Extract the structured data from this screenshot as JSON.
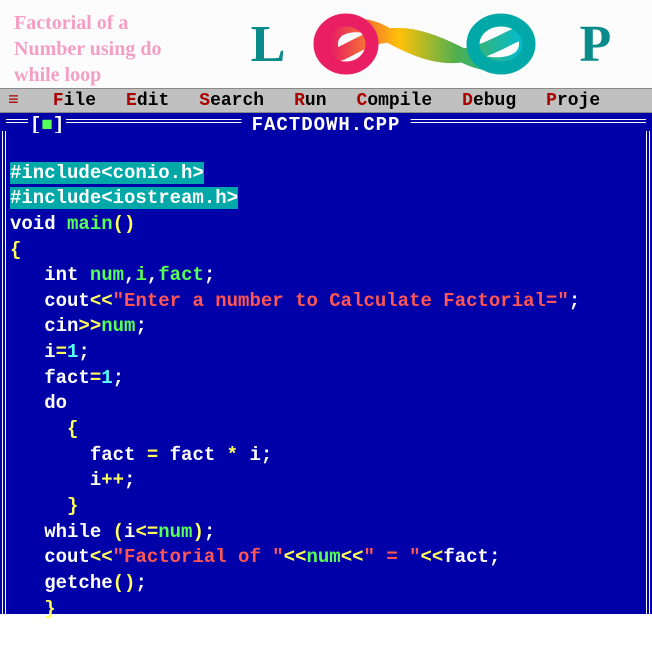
{
  "header": {
    "title": "Factorial of a Number using do while loop",
    "logo_l": "L",
    "logo_p": "P"
  },
  "menu": {
    "icon": "≡",
    "items": [
      {
        "hotkey": "F",
        "rest": "ile"
      },
      {
        "hotkey": "E",
        "rest": "dit"
      },
      {
        "hotkey": "S",
        "rest": "earch"
      },
      {
        "hotkey": "R",
        "rest": "un"
      },
      {
        "hotkey": "C",
        "rest": "ompile"
      },
      {
        "hotkey": "D",
        "rest": "ebug"
      },
      {
        "hotkey": "P",
        "rest": "roje"
      }
    ]
  },
  "ide": {
    "window_ctrl_l": "[",
    "window_ctrl_box": "■",
    "window_ctrl_r": "]",
    "filename": "FACTDOWH.CPP"
  },
  "code": {
    "l1": "#include<conio.h>",
    "l2": "#include<iostream.h>",
    "l3a": "void ",
    "l3b": "main",
    "l3c": "(",
    "l3d": ")",
    "l4": "{",
    "l5a": "   int ",
    "l5b": "num",
    "l5c": ",",
    "l5d": "i",
    "l5e": ",",
    "l5f": "fact",
    "l5g": ";",
    "l6a": "   cout",
    "l6b": "<<",
    "l6c": "\"Enter a number to Calculate Factorial=\"",
    "l6d": ";",
    "l7a": "   cin",
    "l7b": ">>",
    "l7c": "num",
    "l7d": ";",
    "l8a": "   i",
    "l8b": "=",
    "l8c": "1",
    "l8d": ";",
    "l9a": "   fact",
    "l9b": "=",
    "l9c": "1",
    "l9d": ";",
    "l10": "   do",
    "l11": "     {",
    "l12a": "       fact ",
    "l12b": "= ",
    "l12c": "fact ",
    "l12d": "* ",
    "l12e": "i",
    "l12f": ";",
    "l13a": "       i",
    "l13b": "++",
    "l13c": ";",
    "l14": "     }",
    "l15a": "   while ",
    "l15b": "(",
    "l15c": "i",
    "l15d": "<=",
    "l15e": "num",
    "l15f": ")",
    "l15g": ";",
    "l16a": "   cout",
    "l16b": "<<",
    "l16c": "\"Factorial of \"",
    "l16d": "<<",
    "l16e": "num",
    "l16f": "<<",
    "l16g": "\" = \"",
    "l16h": "<<",
    "l16i": "fact",
    "l16j": ";",
    "l17a": "   getche",
    "l17b": "(",
    "l17c": ")",
    "l17d": ";",
    "l18": "   }"
  }
}
